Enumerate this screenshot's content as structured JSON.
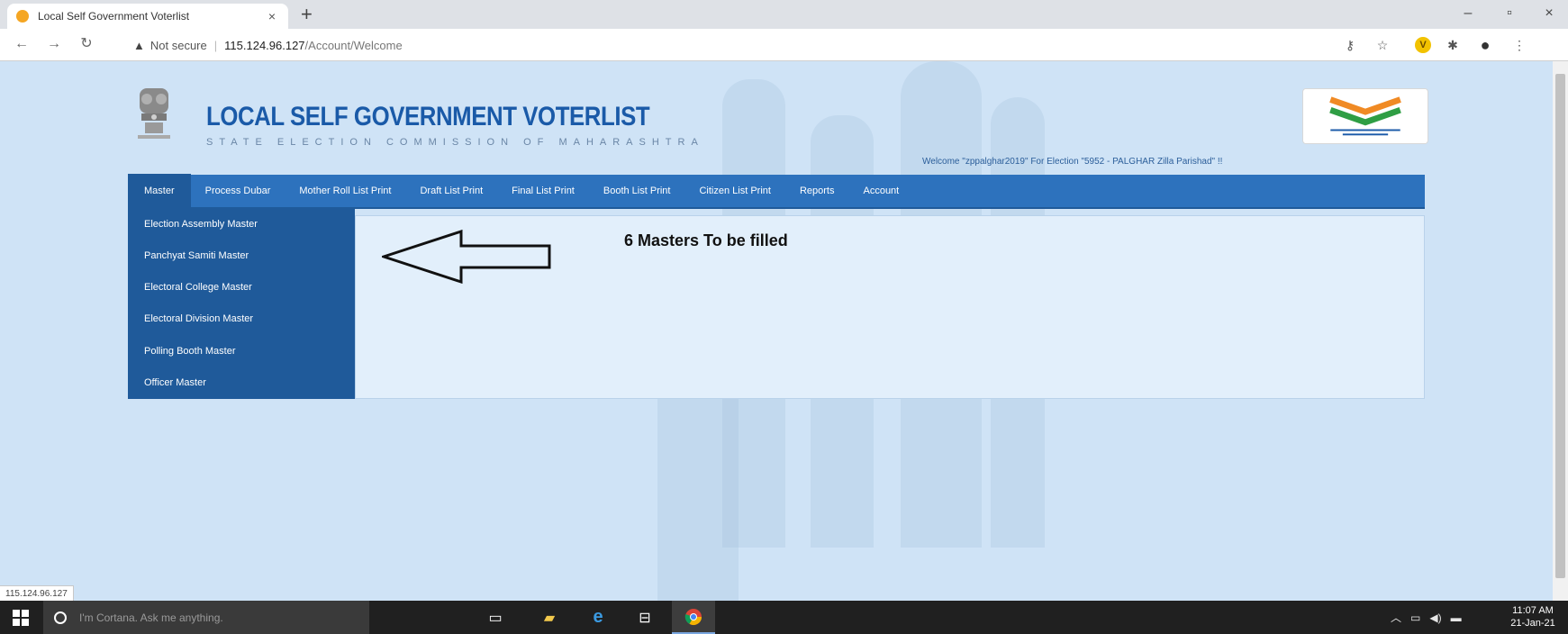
{
  "browser": {
    "tab_title": "Local Self Government Voterlist",
    "tab_close": "×",
    "new_tab": "+",
    "not_secure": "Not secure",
    "url_host": "115.124.96.127",
    "url_path": "/Account/Welcome",
    "window_controls": {
      "minimize": "–",
      "restore": "▫",
      "close": "×"
    },
    "status_url": "115.124.96.127",
    "icons": [
      "back-icon",
      "forward-icon",
      "reload-icon",
      "key-icon",
      "star-icon",
      "extension-v-icon",
      "puzzle-icon",
      "profile-icon",
      "menu-dots-icon"
    ]
  },
  "header": {
    "title": "LOCAL SELF GOVERNMENT VOTERLIST",
    "subtitle": "STATE ELECTION COMMISSION OF MAHARASHTRA",
    "welcome": "Welcome \"zppalghar2019\" For Election \"5952 - PALGHAR Zilla Parishad\" !!"
  },
  "menu": {
    "items": [
      {
        "label": "Master",
        "active": true
      },
      {
        "label": "Process Dubar"
      },
      {
        "label": "Mother Roll List Print"
      },
      {
        "label": "Draft List Print"
      },
      {
        "label": "Final List Print"
      },
      {
        "label": "Booth List Print"
      },
      {
        "label": "Citizen List Print"
      },
      {
        "label": "Reports"
      },
      {
        "label": "Account"
      }
    ],
    "master_dropdown": [
      "Election Assembly Master",
      "Panchyat Samiti Master",
      "Electoral College Master",
      "Electoral Division Master",
      "Polling Booth Master",
      "Officer Master"
    ]
  },
  "annotation": {
    "text": "6 Masters To be filled"
  },
  "taskbar": {
    "cortana_placeholder": "I'm Cortana. Ask me anything.",
    "apps": [
      "task-view-icon",
      "file-explorer-icon",
      "edge-icon",
      "store-icon",
      "chrome-icon"
    ],
    "time": "11:07 AM",
    "date": "21-Jan-21"
  },
  "colors": {
    "menu_bar": "#2d72bd",
    "menu_active": "#1f5a9a",
    "page_bg": "#cfe3f6",
    "title": "#1a5aa8"
  }
}
